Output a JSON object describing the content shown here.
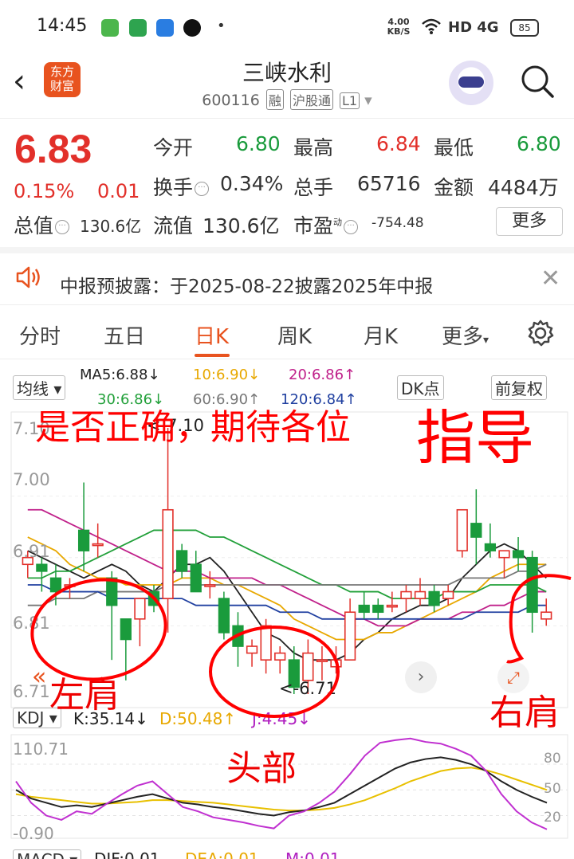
{
  "status_bar": {
    "time": "14:45",
    "net_speed": "4.00 KB/S",
    "signal": "HD 4G",
    "battery": "85"
  },
  "header": {
    "stock_name": "三峡水利",
    "stock_code": "600116",
    "tags": [
      "融",
      "沪股通",
      "L1"
    ],
    "logo_text": "东方\n财富"
  },
  "quote": {
    "price": "6.83",
    "change_pct": "0.15%",
    "change_abs": "0.01",
    "open_label": "今开",
    "open": "6.80",
    "high_label": "最高",
    "high": "6.84",
    "low_label": "最低",
    "low": "6.80",
    "turnover_label": "换手",
    "turnover": "0.34%",
    "volume_label": "总手",
    "volume": "65716",
    "amount_label": "金额",
    "amount": "4484万",
    "mktcap_label": "总值",
    "mktcap": "130.6亿",
    "float_label": "流值",
    "float_cap": "130.6亿",
    "pe_label": "市盈",
    "pe_sup": "动",
    "pe": "-754.48",
    "more": "更多"
  },
  "notice": {
    "text": "中报预披露：于2025-08-22披露2025年中报"
  },
  "tabs": [
    "分时",
    "五日",
    "日K",
    "周K",
    "月K",
    "更多"
  ],
  "ma_bar": {
    "selector": "均线",
    "ma5": "MA5:6.88↓",
    "ma10": "10:6.90↓",
    "ma20": "20:6.86↑",
    "ma30": "30:6.86↓",
    "ma60": "60:6.90↑",
    "ma120": "120:6.84↑",
    "dk": "DK点",
    "adjust": "前复权"
  },
  "kline": {
    "y_labels": [
      "7.10",
      "7.00",
      "6.91",
      "6.81",
      "6.71"
    ],
    "high_marker": "<-7.10",
    "low_marker": "<-6.71"
  },
  "kdj_bar": {
    "selector": "KDJ",
    "k": "K:35.14↓",
    "d": "D:50.48↑",
    "j": "J:4.45↓"
  },
  "kdj_chart": {
    "y_top": "110.71",
    "y_bottom": "-0.90",
    "ref80": "80",
    "ref50": "50",
    "ref20": "20"
  },
  "macd_bar": {
    "selector": "MACD",
    "dif": "DIF:0.01",
    "dea": "DEA:0.01",
    "m": "M:0.01"
  },
  "annotations": {
    "question": "是否正确，期待各位",
    "guide": "指导",
    "left_shoulder": "左肩",
    "head": "头部",
    "right_shoulder": "右肩"
  },
  "colors": {
    "up": "#e2302a",
    "down": "#1a9b3c",
    "accent": "#e8531f",
    "annotation": "#ff0000"
  },
  "chart_data": {
    "type": "candlestick",
    "candles": [
      {
        "o": 6.9,
        "h": 6.92,
        "l": 6.88,
        "c": 6.91
      },
      {
        "o": 6.9,
        "h": 6.91,
        "l": 6.86,
        "c": 6.89
      },
      {
        "o": 6.88,
        "h": 6.9,
        "l": 6.84,
        "c": 6.86
      },
      {
        "o": 6.87,
        "h": 6.88,
        "l": 6.85,
        "c": 6.87
      },
      {
        "o": 6.95,
        "h": 7.02,
        "l": 6.89,
        "c": 6.92
      },
      {
        "o": 6.93,
        "h": 6.96,
        "l": 6.91,
        "c": 6.93
      },
      {
        "o": 6.88,
        "h": 6.89,
        "l": 6.76,
        "c": 6.84
      },
      {
        "o": 6.82,
        "h": 6.82,
        "l": 6.73,
        "c": 6.79
      },
      {
        "o": 6.82,
        "h": 6.85,
        "l": 6.78,
        "c": 6.85
      },
      {
        "o": 6.86,
        "h": 6.87,
        "l": 6.83,
        "c": 6.84
      },
      {
        "o": 6.85,
        "h": 7.1,
        "l": 6.8,
        "c": 6.98
      },
      {
        "o": 6.92,
        "h": 6.93,
        "l": 6.88,
        "c": 6.89
      },
      {
        "o": 6.9,
        "h": 6.92,
        "l": 6.86,
        "c": 6.86
      },
      {
        "o": 6.87,
        "h": 6.89,
        "l": 6.85,
        "c": 6.87
      },
      {
        "o": 6.85,
        "h": 6.86,
        "l": 6.79,
        "c": 6.8
      },
      {
        "o": 6.81,
        "h": 6.83,
        "l": 6.75,
        "c": 6.78
      },
      {
        "o": 6.77,
        "h": 6.79,
        "l": 6.75,
        "c": 6.78
      },
      {
        "o": 6.76,
        "h": 6.82,
        "l": 6.74,
        "c": 6.81
      },
      {
        "o": 6.76,
        "h": 6.78,
        "l": 6.74,
        "c": 6.77
      },
      {
        "o": 6.76,
        "h": 6.78,
        "l": 6.71,
        "c": 6.72
      },
      {
        "o": 6.73,
        "h": 6.79,
        "l": 6.71,
        "c": 6.77
      },
      {
        "o": 6.76,
        "h": 6.78,
        "l": 6.73,
        "c": 6.76
      },
      {
        "o": 6.75,
        "h": 6.78,
        "l": 6.74,
        "c": 6.76
      },
      {
        "o": 6.76,
        "h": 6.85,
        "l": 6.76,
        "c": 6.83
      },
      {
        "o": 6.84,
        "h": 6.86,
        "l": 6.82,
        "c": 6.83
      },
      {
        "o": 6.84,
        "h": 6.85,
        "l": 6.82,
        "c": 6.83
      },
      {
        "o": 6.84,
        "h": 6.86,
        "l": 6.83,
        "c": 6.84
      },
      {
        "o": 6.85,
        "h": 6.87,
        "l": 6.83,
        "c": 6.86
      },
      {
        "o": 6.85,
        "h": 6.88,
        "l": 6.84,
        "c": 6.86
      },
      {
        "o": 6.86,
        "h": 6.87,
        "l": 6.83,
        "c": 6.84
      },
      {
        "o": 6.85,
        "h": 6.87,
        "l": 6.84,
        "c": 6.86
      },
      {
        "o": 6.92,
        "h": 6.98,
        "l": 6.91,
        "c": 6.98
      },
      {
        "o": 6.96,
        "h": 7.01,
        "l": 6.9,
        "c": 6.94
      },
      {
        "o": 6.93,
        "h": 6.96,
        "l": 6.91,
        "c": 6.92
      },
      {
        "o": 6.91,
        "h": 6.92,
        "l": 6.88,
        "c": 6.92
      },
      {
        "o": 6.92,
        "h": 6.94,
        "l": 6.89,
        "c": 6.91
      },
      {
        "o": 6.91,
        "h": 6.92,
        "l": 6.8,
        "c": 6.83
      },
      {
        "o": 6.82,
        "h": 6.85,
        "l": 6.81,
        "c": 6.83
      }
    ],
    "ma_lines": [
      {
        "name": "MA5",
        "color": "#222222",
        "values": [
          6.92,
          6.91,
          6.9,
          6.89,
          6.88,
          6.89,
          6.9,
          6.89,
          6.87,
          6.86,
          6.88,
          6.9,
          6.9,
          6.91,
          6.89,
          6.86,
          6.83,
          6.8,
          6.79,
          6.77,
          6.76,
          6.76,
          6.76,
          6.77,
          6.79,
          6.8,
          6.82,
          6.83,
          6.84,
          6.84,
          6.85,
          6.88,
          6.9,
          6.92,
          6.93,
          6.92,
          6.9,
          6.88
        ]
      },
      {
        "name": "MA10",
        "color": "#e8a800",
        "values": [
          6.94,
          6.93,
          6.92,
          6.9,
          6.89,
          6.88,
          6.88,
          6.87,
          6.87,
          6.87,
          6.87,
          6.88,
          6.88,
          6.88,
          6.87,
          6.87,
          6.86,
          6.85,
          6.84,
          6.82,
          6.81,
          6.8,
          6.79,
          6.79,
          6.79,
          6.8,
          6.8,
          6.81,
          6.82,
          6.83,
          6.84,
          6.85,
          6.86,
          6.88,
          6.89,
          6.9,
          6.9,
          6.9
        ]
      },
      {
        "name": "MA20",
        "color": "#c0208a",
        "values": [
          6.98,
          6.98,
          6.97,
          6.96,
          6.95,
          6.94,
          6.93,
          6.92,
          6.91,
          6.9,
          6.89,
          6.89,
          6.89,
          6.88,
          6.88,
          6.88,
          6.88,
          6.87,
          6.87,
          6.86,
          6.85,
          6.84,
          6.83,
          6.82,
          6.82,
          6.81,
          6.81,
          6.81,
          6.82,
          6.82,
          6.82,
          6.83,
          6.83,
          6.84,
          6.84,
          6.85,
          6.86,
          6.86
        ]
      },
      {
        "name": "MA30",
        "color": "#22a03a",
        "values": [
          6.88,
          6.88,
          6.89,
          6.89,
          6.9,
          6.91,
          6.92,
          6.93,
          6.94,
          6.95,
          6.95,
          6.95,
          6.95,
          6.94,
          6.94,
          6.93,
          6.92,
          6.91,
          6.9,
          6.89,
          6.88,
          6.87,
          6.87,
          6.86,
          6.86,
          6.86,
          6.85,
          6.85,
          6.85,
          6.85,
          6.86,
          6.86,
          6.86,
          6.87,
          6.87,
          6.87,
          6.87,
          6.86
        ]
      },
      {
        "name": "MA60",
        "color": "#777777",
        "values": [
          6.84,
          6.84,
          6.85,
          6.85,
          6.85,
          6.86,
          6.86,
          6.86,
          6.86,
          6.86,
          6.87,
          6.87,
          6.87,
          6.87,
          6.87,
          6.87,
          6.87,
          6.87,
          6.87,
          6.87,
          6.87,
          6.87,
          6.87,
          6.87,
          6.87,
          6.87,
          6.87,
          6.87,
          6.87,
          6.87,
          6.87,
          6.88,
          6.88,
          6.88,
          6.88,
          6.89,
          6.89,
          6.9
        ]
      },
      {
        "name": "MA120",
        "color": "#2040a0",
        "values": [
          6.87,
          6.87,
          6.86,
          6.86,
          6.86,
          6.86,
          6.85,
          6.85,
          6.85,
          6.85,
          6.85,
          6.85,
          6.84,
          6.84,
          6.84,
          6.84,
          6.84,
          6.84,
          6.83,
          6.83,
          6.83,
          6.82,
          6.82,
          6.82,
          6.82,
          6.82,
          6.82,
          6.82,
          6.82,
          6.82,
          6.82,
          6.82,
          6.83,
          6.83,
          6.83,
          6.83,
          6.84,
          6.84
        ]
      }
    ],
    "kdj": {
      "k": [
        50,
        40,
        35,
        30,
        32,
        30,
        34,
        38,
        42,
        45,
        40,
        35,
        33,
        30,
        28,
        25,
        22,
        20,
        24,
        26,
        30,
        35,
        45,
        55,
        65,
        75,
        82,
        86,
        88,
        85,
        80,
        72,
        60,
        50,
        42,
        35
      ],
      "d": [
        45,
        42,
        40,
        38,
        36,
        34,
        34,
        35,
        36,
        38,
        38,
        37,
        36,
        35,
        33,
        31,
        29,
        27,
        26,
        26,
        27,
        29,
        33,
        38,
        45,
        52,
        60,
        66,
        72,
        75,
        76,
        73,
        68,
        62,
        56,
        50
      ],
      "j": [
        60,
        35,
        20,
        15,
        25,
        22,
        34,
        45,
        55,
        60,
        45,
        30,
        25,
        18,
        15,
        12,
        8,
        5,
        20,
        25,
        35,
        48,
        68,
        90,
        105,
        108,
        110,
        106,
        104,
        98,
        90,
        72,
        45,
        25,
        12,
        4
      ]
    }
  }
}
